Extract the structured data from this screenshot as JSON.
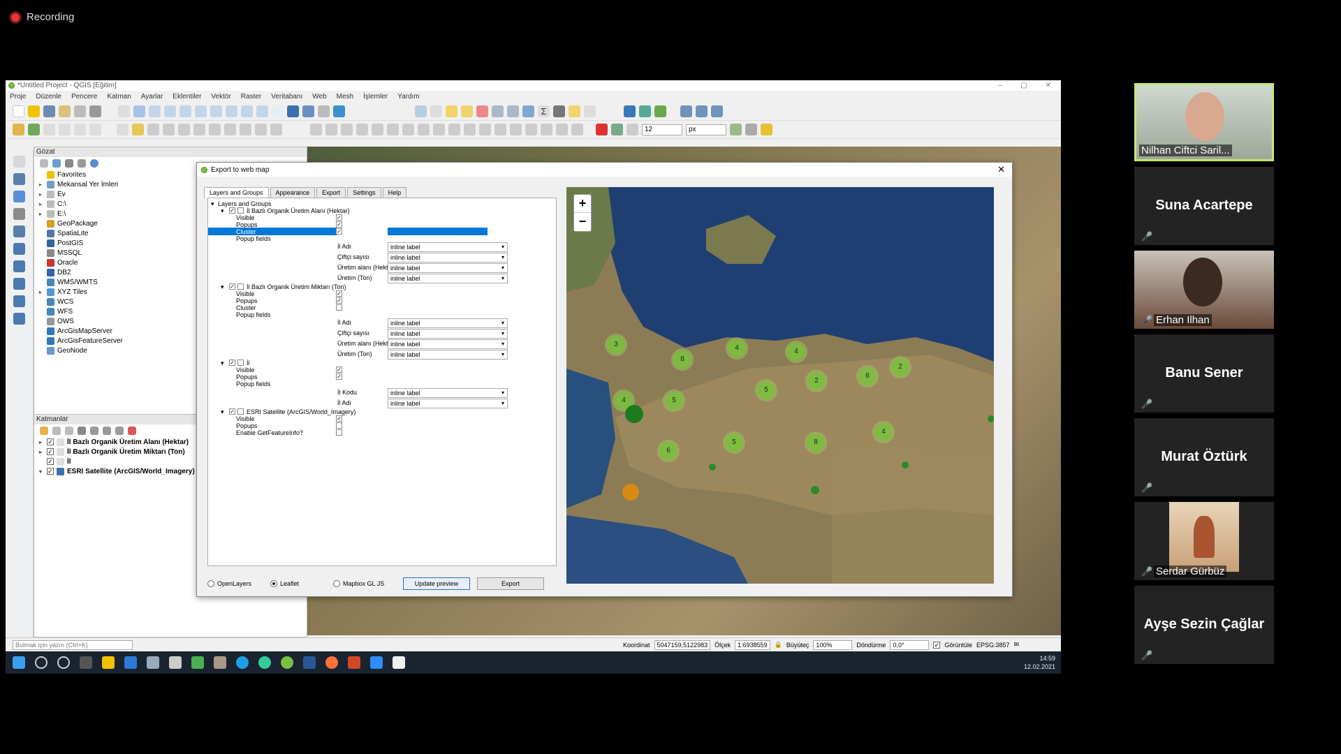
{
  "recording": {
    "label": "Recording"
  },
  "qgis": {
    "window_title": "*Untitled Project - QGIS [Eğitim]",
    "menu": [
      "Proje",
      "Düzenle",
      "Pencere",
      "Katman",
      "Ayarlar",
      "Eklentiler",
      "Vektör",
      "Raster",
      "Veritabanı",
      "Web",
      "Mesh",
      "İşlemler",
      "Yardım"
    ],
    "toolbar": {
      "size_value": "12",
      "unit_value": "px"
    },
    "browser": {
      "title": "Gözat",
      "items": [
        {
          "label": "Favorites",
          "color": "#f2c200",
          "arrow": ""
        },
        {
          "label": "Mekansal Yer İmleri",
          "color": "#7a9ec8",
          "arrow": "▸"
        },
        {
          "label": "Ev",
          "color": "#bbbbbb",
          "arrow": "▸"
        },
        {
          "label": "C:\\",
          "color": "#bbbbbb",
          "arrow": "▸"
        },
        {
          "label": "E:\\",
          "color": "#bbbbbb",
          "arrow": "▸"
        },
        {
          "label": "GeoPackage",
          "color": "#d8a020",
          "arrow": ""
        },
        {
          "label": "SpatiaLite",
          "color": "#5577aa",
          "arrow": ""
        },
        {
          "label": "PostGIS",
          "color": "#336699",
          "arrow": ""
        },
        {
          "label": "MSSQL",
          "color": "#888888",
          "arrow": ""
        },
        {
          "label": "Oracle",
          "color": "#cc3333",
          "arrow": ""
        },
        {
          "label": "DB2",
          "color": "#3366aa",
          "arrow": ""
        },
        {
          "label": "WMS/WMTS",
          "color": "#4488bb",
          "arrow": ""
        },
        {
          "label": "XYZ Tiles",
          "color": "#5599cc",
          "arrow": "▸"
        },
        {
          "label": "WCS",
          "color": "#4488bb",
          "arrow": ""
        },
        {
          "label": "WFS",
          "color": "#4488bb",
          "arrow": ""
        },
        {
          "label": "OWS",
          "color": "#999999",
          "arrow": ""
        },
        {
          "label": "ArcGisMapServer",
          "color": "#3377bb",
          "arrow": ""
        },
        {
          "label": "ArcGisFeatureServer",
          "color": "#3377bb",
          "arrow": ""
        },
        {
          "label": "GeoNode",
          "color": "#6699cc",
          "arrow": ""
        }
      ]
    },
    "layers_panel": {
      "title": "Katmanlar",
      "layers": [
        {
          "label": "İl Bazlı Organik Üretim Alanı (Hektar)",
          "checked": "✓",
          "arrow": "▸"
        },
        {
          "label": "İl Bazlı Organik Üretim Miktarı (Ton)",
          "checked": "✓",
          "arrow": "▸"
        },
        {
          "label": "İl",
          "checked": "✓",
          "arrow": ""
        },
        {
          "label": "ESRI Satellite (ArcGIS/World_Imagery)",
          "checked": "✓",
          "arrow": "▾"
        }
      ]
    },
    "search_placeholder": "Bulmak için yazın (Ctrl+K)",
    "status": {
      "coord_label": "Koordinat",
      "coord_value": "5047159,5122983",
      "scale_label": "Ölçek",
      "scale_value": "1:6938559",
      "magnifier_label": "Büyüteç",
      "magnifier_value": "100%",
      "rotation_label": "Döndürme",
      "rotation_value": "0,0°",
      "render_label": "Görüntüle",
      "crs": "EPSG:3857"
    },
    "clock": {
      "time": "14:59",
      "date": "12.02.2021"
    }
  },
  "dialog": {
    "title": "Export to web map",
    "tabs": [
      "Layers and Groups",
      "Appearance",
      "Export",
      "Settings",
      "Help"
    ],
    "tree_root": "Layers and Groups",
    "group1": {
      "title": "İl Bazlı Organik Üretim Alanı (Hektar)",
      "visible": "Visible",
      "popups": "Popups",
      "cluster": "Cluster",
      "popup_fields": "Popup fields",
      "fields": [
        {
          "name": "İl Adı",
          "value": "inline label"
        },
        {
          "name": "Çiftçi sayısı",
          "value": "inline label"
        },
        {
          "name": "Üretim alanı (Hektar)",
          "value": "inline label"
        },
        {
          "name": "Üretim  (Ton)",
          "value": "inline label"
        }
      ]
    },
    "group2": {
      "title": "İl Bazlı Organik Üretim Miktarı (Ton)",
      "visible": "Visible",
      "popups": "Popups",
      "cluster": "Cluster",
      "popup_fields": "Popup fields",
      "fields": [
        {
          "name": "İl Adı",
          "value": "inline label"
        },
        {
          "name": "Çiftçi sayısı",
          "value": "inline label"
        },
        {
          "name": "Üretim alanı (Hektar)",
          "value": "inline label"
        },
        {
          "name": "Üretim  (Ton)",
          "value": "inline label"
        }
      ]
    },
    "group3": {
      "title": "İl",
      "visible": "Visible",
      "popups": "Popups",
      "popup_fields": "Popup fields",
      "fields": [
        {
          "name": "İl Kodu",
          "value": "inline label"
        },
        {
          "name": "İl Adı",
          "value": "inline label"
        }
      ]
    },
    "group4": {
      "title": "ESRI Satellite (ArcGIS/World_Imagery)",
      "visible": "Visible",
      "popups": "Popups",
      "getfeature": "Enable GetFeatureInfo?"
    },
    "radios": [
      "OpenLayers",
      "Leaflet",
      "Mapbox GL JS"
    ],
    "update_button": "Update preview",
    "export_button": "Export",
    "zoom_in": "+",
    "zoom_out": "−",
    "clusters": [
      "3",
      "8",
      "4",
      "4",
      "2",
      "2",
      "6",
      "4",
      "5",
      "5",
      "5",
      "8",
      "6",
      "4"
    ]
  },
  "participants": [
    {
      "name": "Nilhan Ciftci Saril...",
      "type": "video"
    },
    {
      "name": "Suna Acartepe",
      "type": "text"
    },
    {
      "name": "Erhan Ilhan",
      "type": "video"
    },
    {
      "name": "Banu Sener",
      "type": "text"
    },
    {
      "name": "Murat Öztürk",
      "type": "text"
    },
    {
      "name": "Serdar Gürbüz",
      "type": "image"
    },
    {
      "name": "Ayşe Sezin Çağlar",
      "type": "text"
    }
  ]
}
